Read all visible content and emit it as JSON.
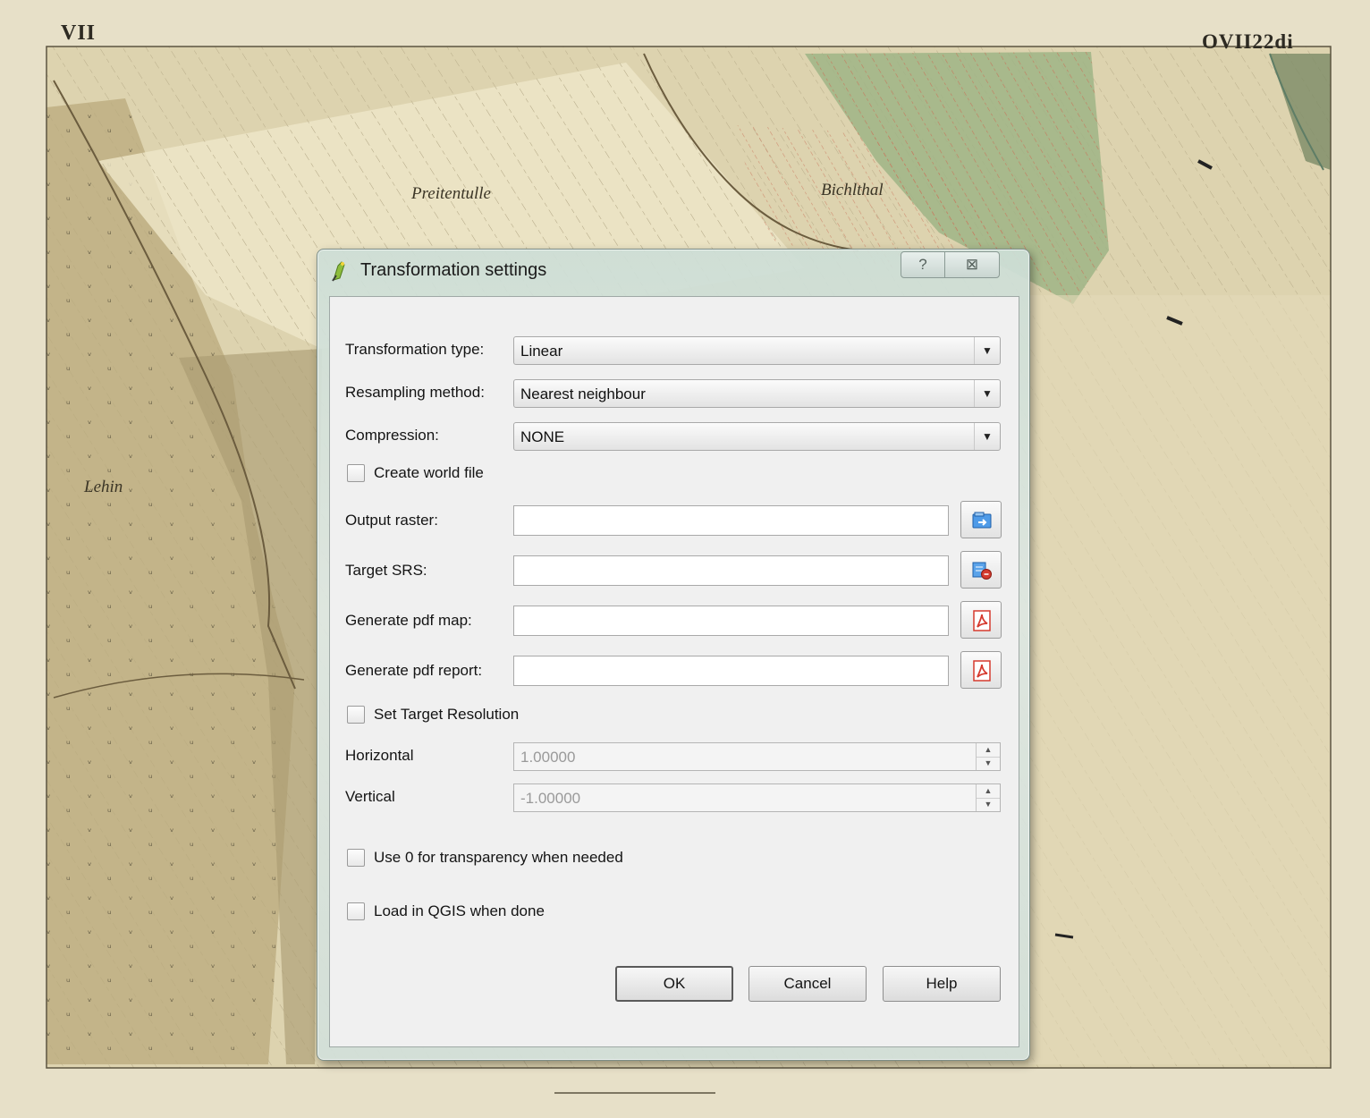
{
  "map": {
    "corner_left": "VII",
    "corner_right": "OVII22di",
    "place_names": [
      "Preitentulle",
      "Bichlthal",
      "Lehin"
    ]
  },
  "dialog": {
    "title": "Transformation settings",
    "help_glyph": "?",
    "close_glyph": "⊠",
    "transformation_type": {
      "label": "Transformation type:",
      "value": "Linear"
    },
    "resampling_method": {
      "label": "Resampling method:",
      "value": "Nearest neighbour"
    },
    "compression": {
      "label": "Compression:",
      "value": "NONE"
    },
    "create_world_file": {
      "label": "Create world file",
      "checked": false
    },
    "output_raster": {
      "label": "Output raster:",
      "value": "",
      "button_icon": "open-file-icon"
    },
    "target_srs": {
      "label": "Target SRS:",
      "value": "",
      "button_icon": "select-crs-icon"
    },
    "pdf_map": {
      "label": "Generate pdf map:",
      "value": "",
      "button_icon": "pdf-icon"
    },
    "pdf_report": {
      "label": "Generate pdf report:",
      "value": "",
      "button_icon": "pdf-icon"
    },
    "set_target_resolution": {
      "label": "Set Target Resolution",
      "checked": false
    },
    "horizontal": {
      "label": "Horizontal",
      "value": "1.00000"
    },
    "vertical": {
      "label": "Vertical",
      "value": "-1.00000"
    },
    "use_zero_transparency": {
      "label": "Use 0 for transparency when needed",
      "checked": false
    },
    "load_in_qgis": {
      "label": "Load in QGIS when done",
      "checked": false
    },
    "buttons": {
      "ok": "OK",
      "cancel": "Cancel",
      "help": "Help"
    },
    "colors": {
      "client_bg": "#f0f0f0",
      "frame_tint": "#cddfd6",
      "pdf_red": "#d63a2e",
      "folder_blue": "#2f7fd1"
    }
  }
}
